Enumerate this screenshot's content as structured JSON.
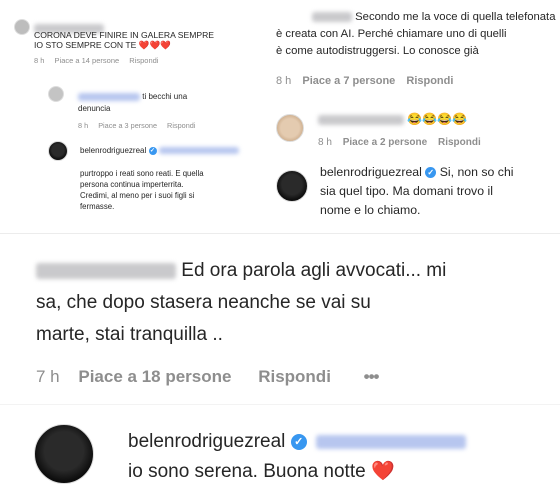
{
  "top_left": {
    "comment_text_1": "CORONA DEVE FINIRE IN GALERA SEMPRE",
    "comment_text_2": "IO STO SEMPRE CON TE",
    "comment_hearts": "❤️❤️❤️",
    "comment_meta": {
      "time": "8 h",
      "likes": "Piace a 14 persone",
      "reply": "Rispondi"
    },
    "reply1_text_1": "ti becchi una",
    "reply1_text_2": "denuncia",
    "reply1_meta": {
      "time": "8 h",
      "likes": "Piace a 3 persone",
      "reply": "Rispondi"
    },
    "reply2_username": "belenrodriguezreal",
    "reply2_text_1": "purtroppo i reati sono reati. E quella",
    "reply2_text_2": "persona continua imperterrita.",
    "reply2_text_3": "Credimi, al meno per i suoi figli si",
    "reply2_text_4": "fermasse."
  },
  "top_right": {
    "comment_text_1": "Secondo me la voce di quella telefonata",
    "comment_text_2": "è creata con AI. Perché chiamare uno di quelli",
    "comment_text_3": "è come autodistruggersi. Lo conosce già",
    "comment_meta": {
      "time": "8 h",
      "likes": "Piace a 7 persone",
      "reply": "Rispondi"
    },
    "reply1_emojis": "😂😂😂😂",
    "reply1_meta": {
      "time": "8 h",
      "likes": "Piace a 2 persone",
      "reply": "Rispondi"
    },
    "reply2_username": "belenrodriguezreal",
    "reply2_text_1": "Si, non so chi",
    "reply2_text_2": "sia quel tipo. Ma domani trovo il",
    "reply2_text_3": "nome e lo chiamo."
  },
  "middle": {
    "comment_text_1": "Ed ora parola agli avvocati... mi",
    "comment_text_2": "sa, che dopo stasera neanche se vai su",
    "comment_text_3": "marte, stai tranquilla ..",
    "comment_meta": {
      "time": "7 h",
      "likes": "Piace a 18 persone",
      "reply": "Rispondi",
      "more": "•••"
    }
  },
  "bottom": {
    "username": "belenrodriguezreal",
    "text": "io sono serena. Buona notte",
    "heart": "❤️"
  },
  "icons": {
    "verified": "verified-badge-icon",
    "heart": "heart-icon",
    "more": "more-options-icon"
  },
  "colors": {
    "verified": "#3897f0",
    "heart": "#ed1c24",
    "meta": "#8e8e8e",
    "text": "#262626"
  }
}
